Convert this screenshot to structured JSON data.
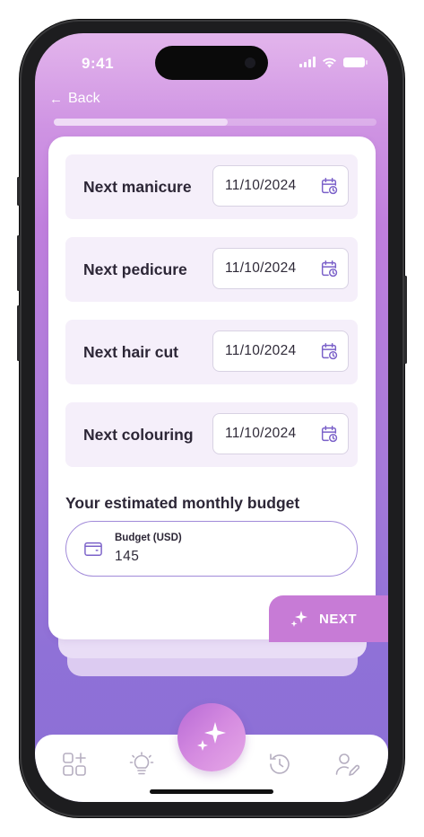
{
  "status_bar": {
    "time": "9:41"
  },
  "header": {
    "back_label": "Back"
  },
  "progress": {
    "fraction": 0.54
  },
  "rows": [
    {
      "label": "Next manicure",
      "date": "11/10/2024"
    },
    {
      "label": "Next pedicure",
      "date": "11/10/2024"
    },
    {
      "label": "Next hair cut",
      "date": "11/10/2024"
    },
    {
      "label": "Next colouring",
      "date": "11/10/2024"
    }
  ],
  "budget": {
    "heading": "Your estimated monthly budget",
    "label": "Budget (USD)",
    "value": "145"
  },
  "next_button": {
    "label": "NEXT"
  },
  "tabbar": {
    "tabs": [
      "grid-plus-icon",
      "lightbulb-icon",
      "sparkles-icon",
      "history-icon",
      "user-edit-icon"
    ]
  },
  "colors": {
    "accent": "#c77bd6",
    "border_accent": "#a18ad9",
    "row_bg": "#f5effa",
    "icon": "#7b61c9"
  }
}
